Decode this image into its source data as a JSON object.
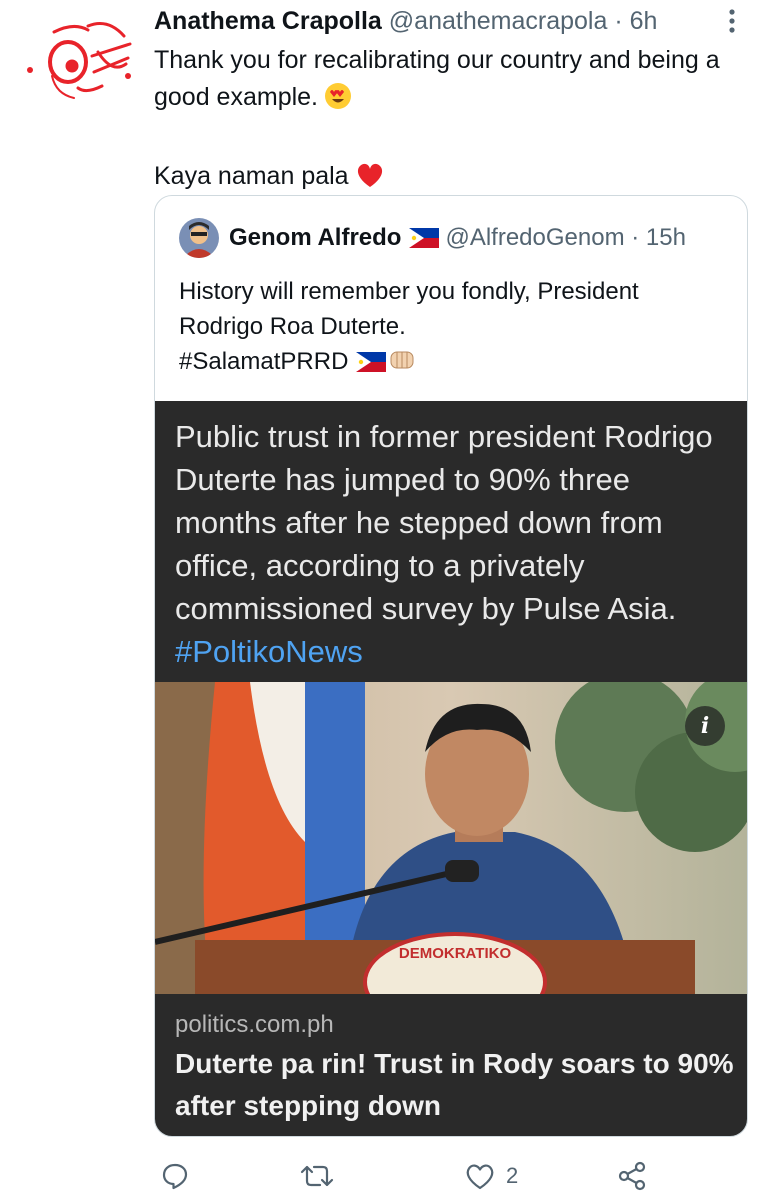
{
  "tweet": {
    "author_name": "Anathema Crapolla",
    "handle": "@anathemacrapola",
    "separator": "·",
    "time": "6h",
    "text_line1": "Thank you for recalibrating our country and being a good example.",
    "text_line2": "Kaya naman pala",
    "emoji_1": "heart-eyes-emoji",
    "emoji_2": "red-heart-emoji"
  },
  "quoted": {
    "author_name": "Genom Alfredo",
    "handle": "@AlfredoGenom",
    "separator": "·",
    "time": "15h",
    "line1": "History will remember you fondly, President",
    "line2": "Rodrigo Roa Duterte.",
    "hashtag": "#SalamatPRRD",
    "flag_icon": "philippine-flag-emoji",
    "fist_icon": "fist-bump-emoji"
  },
  "card": {
    "lead_text": "Public trust in former president Rodrigo Duterte has jumped to 90% three months after he stepped down from office, according to a privately commissioned survey by Pulse Asia.",
    "tag": "#PoltikoNews",
    "podium_text": "DEMOKRATIKO",
    "info_label": "i",
    "domain": "politics.com.ph",
    "headline": "Duterte pa rin! Trust in Rody soars to 90% after stepping down"
  },
  "actions": {
    "reply_icon": "reply-icon",
    "retweet_icon": "retweet-icon",
    "like_icon": "like-icon",
    "like_count": "2",
    "share_icon": "share-icon"
  },
  "colors": {
    "text": "#0f1419",
    "muted": "#536471",
    "card_bg": "#2a2a2a",
    "link": "#4fa3f2"
  }
}
